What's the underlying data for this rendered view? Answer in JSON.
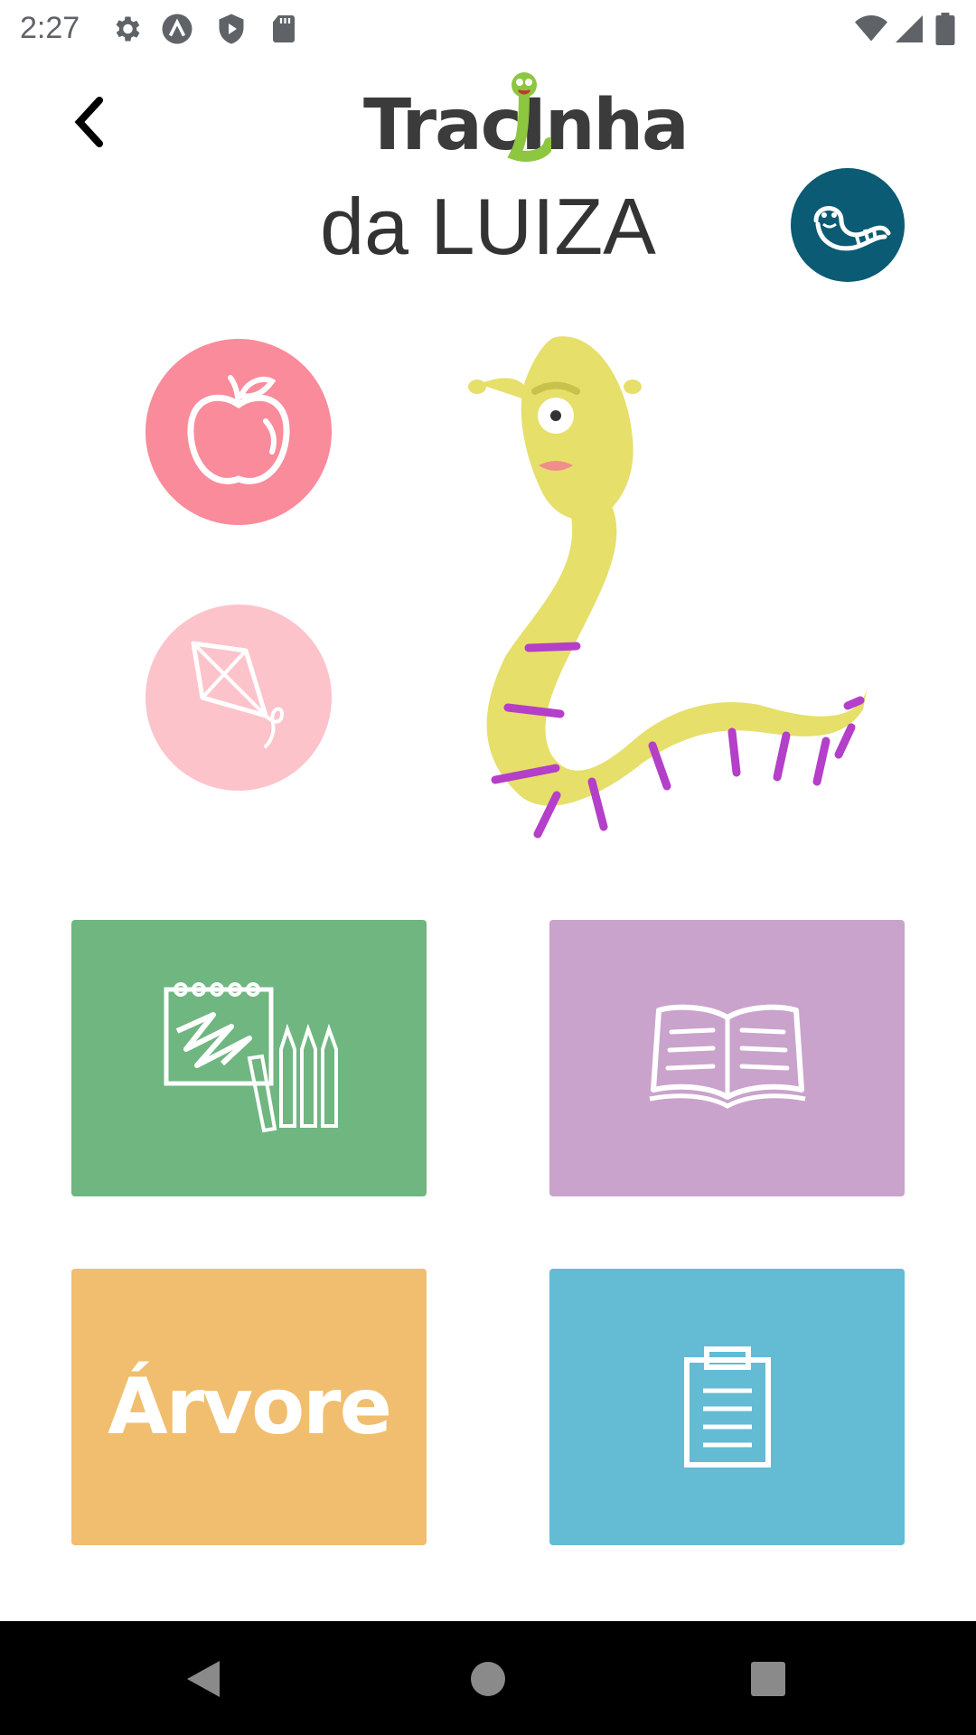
{
  "status_bar": {
    "time": "2:27",
    "icons": [
      "settings-icon",
      "app-a-icon",
      "shield-play-icon",
      "sd-card-icon",
      "wifi-icon",
      "signal-icon",
      "battery-icon"
    ]
  },
  "header": {
    "logo_text": "TracInha",
    "subtitle": "da LUIZA",
    "back_icon": "chevron-left-icon",
    "avatar_icon": "worm-face-icon"
  },
  "activities": {
    "apple_icon": "apple-icon",
    "kite_icon": "kite-icon"
  },
  "tiles": {
    "draw_icon": "drawing-pencils-icon",
    "book_icon": "open-book-icon",
    "tree_label": "Árvore",
    "clipboard_icon": "clipboard-icon"
  },
  "colors": {
    "apple_circle": "#f98b9a",
    "kite_circle": "#fdc3cb",
    "avatar": "#0a5b73",
    "green_tile": "#6fb680",
    "purple_tile": "#c9a3cc",
    "orange_tile": "#f0be6e",
    "blue_tile": "#63bbd4",
    "worm_body": "#e6df6a",
    "worm_stripes": "#b43fc9"
  }
}
